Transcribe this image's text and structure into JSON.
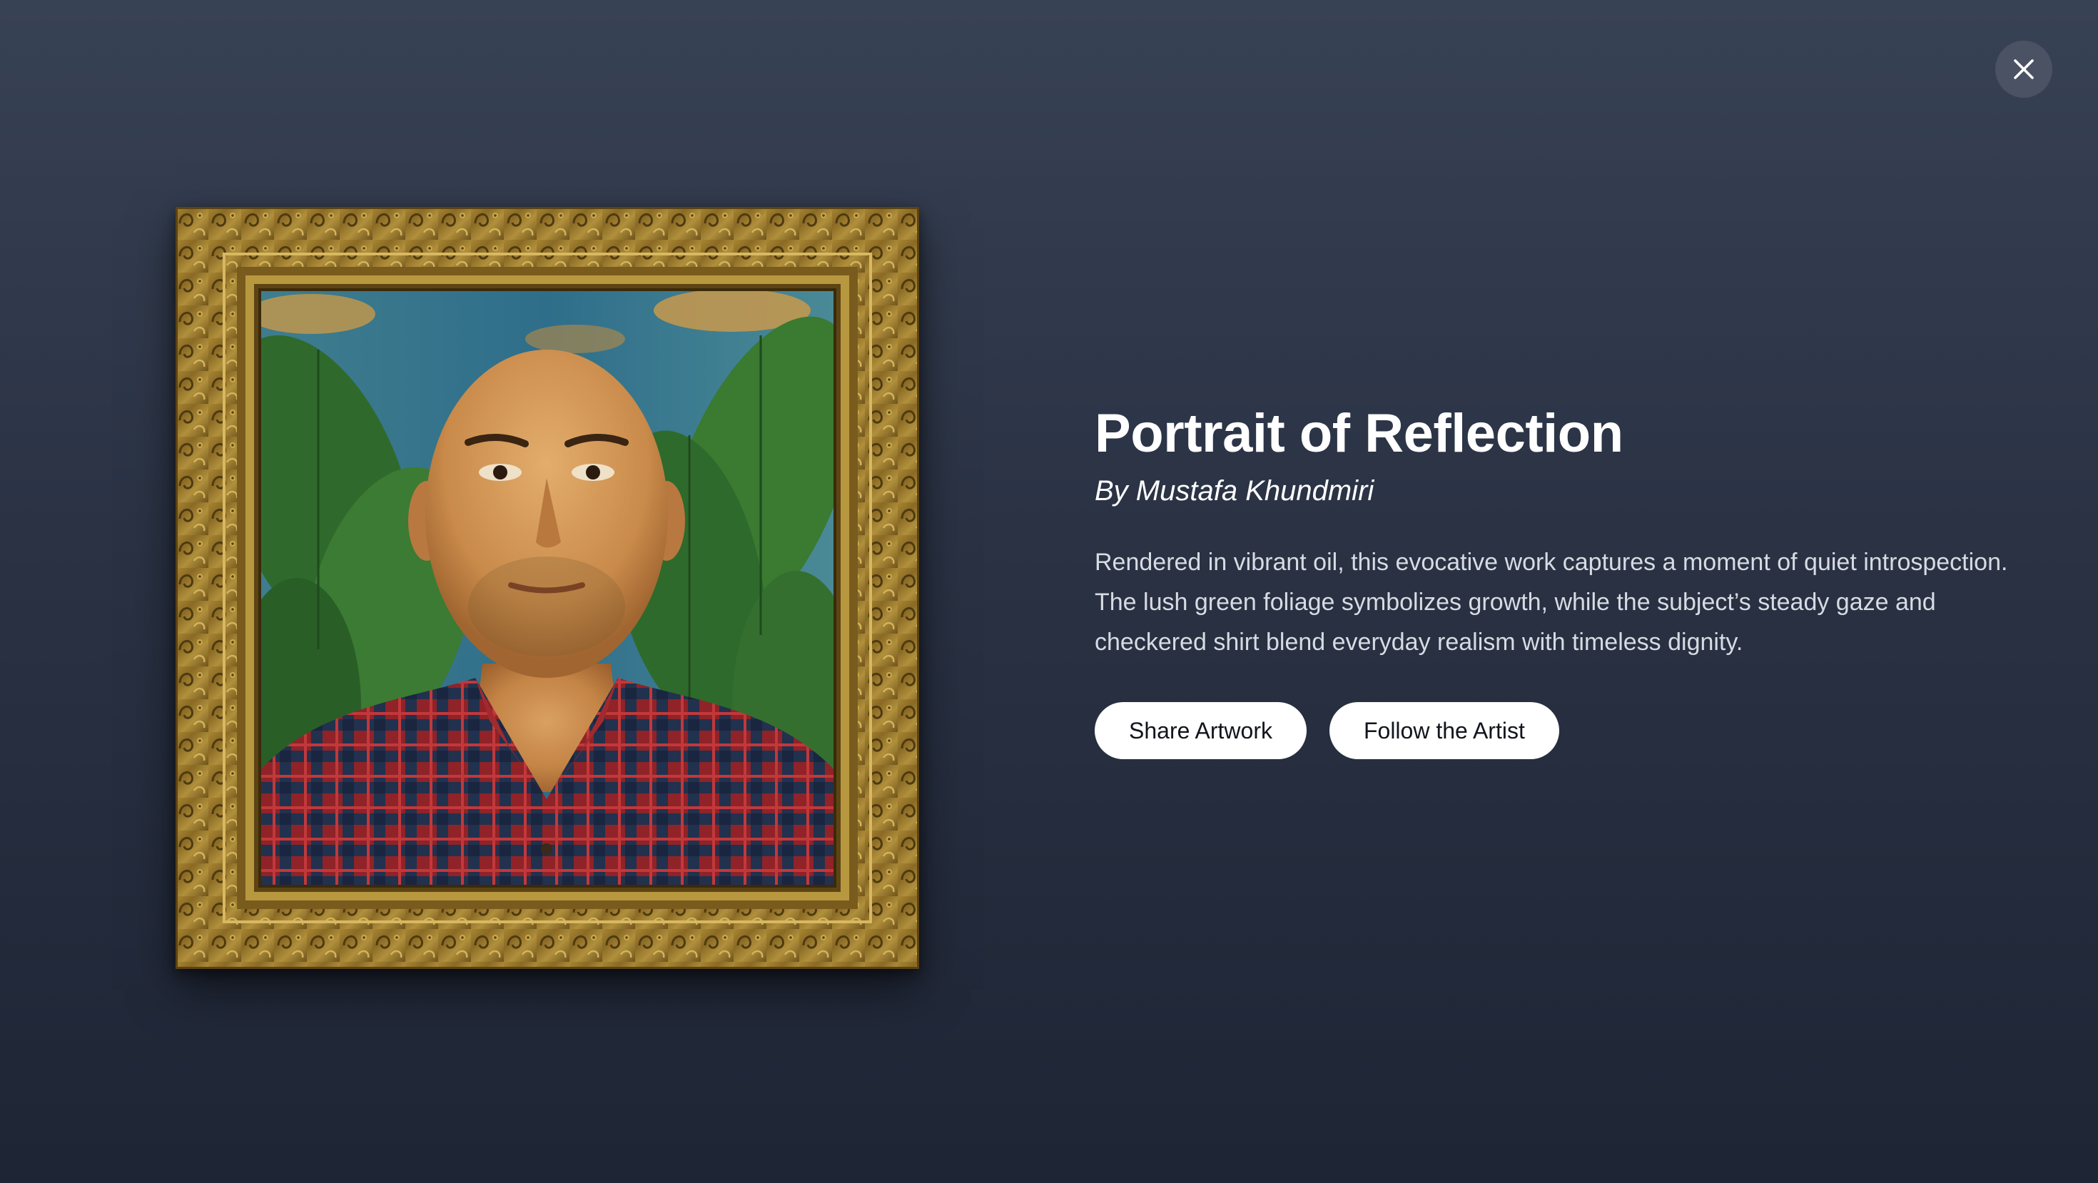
{
  "artwork": {
    "title": "Portrait of Reflection",
    "artist_line": "By Mustafa Khundmiri",
    "description": "Rendered in vibrant oil, this evocative work captures a moment of quiet introspection. The lush green foliage symbolizes growth, while the subject’s steady gaze and checkered shirt blend everyday realism with timeless dignity.",
    "image": "framed-portrait-painting"
  },
  "actions": {
    "share_label": "Share Artwork",
    "follow_label": "Follow the Artist"
  },
  "controls": {
    "close_icon": "close-icon"
  },
  "colors": {
    "background_top": "#384255",
    "background_bottom": "#1e2535",
    "button_bg": "#ffffff",
    "button_text": "#12151c",
    "description_text": "#d7dbe3",
    "close_button_bg": "#4a5263"
  }
}
